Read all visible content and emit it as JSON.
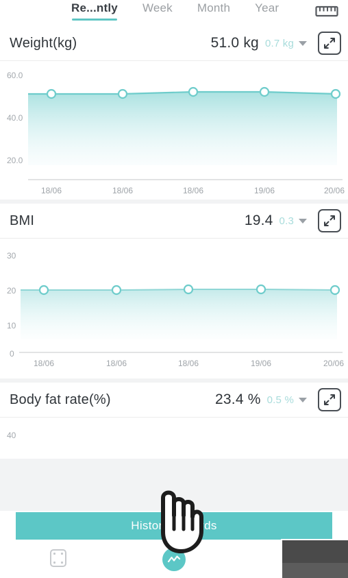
{
  "header": {
    "tabs": [
      {
        "label": "Re...ntly",
        "active": true
      },
      {
        "label": "Week",
        "active": false
      },
      {
        "label": "Month",
        "active": false
      },
      {
        "label": "Year",
        "active": false
      }
    ],
    "ruler_icon": "ruler-icon"
  },
  "colors": {
    "accent": "#5cc7c6",
    "line": "#6ecccb",
    "delta_text": "#a8dcdb",
    "value_text": "#2f3439",
    "tab_inactive": "#9b9fa3",
    "page_bg": "#f2f3f4"
  },
  "cards": [
    {
      "title": "Weight(kg)",
      "value": "51.0 kg",
      "delta": "0.7 kg",
      "expand_icon": "expand-icon",
      "caret_icon": "chevron-down-icon"
    },
    {
      "title": "BMI",
      "value": "19.4",
      "delta": "0.3",
      "expand_icon": "expand-icon",
      "caret_icon": "chevron-down-icon"
    },
    {
      "title": "Body fat rate(%)",
      "value": "23.4 %",
      "delta": "0.5 %",
      "expand_icon": "expand-icon",
      "caret_icon": "chevron-down-icon"
    }
  ],
  "chart_data": [
    {
      "type": "area",
      "title": "Weight(kg)",
      "categories": [
        "18/06",
        "18/06",
        "18/06",
        "19/06",
        "20/06"
      ],
      "values": [
        51.0,
        51.0,
        51.2,
        51.2,
        51.0
      ],
      "xlabel": "",
      "ylabel": "",
      "ylim": [
        10,
        62
      ],
      "yticks": [
        "60.0",
        "40.0",
        "20.0"
      ],
      "ytick_values": [
        60,
        40,
        20
      ],
      "grid": false,
      "legend": "none"
    },
    {
      "type": "area",
      "title": "BMI",
      "categories": [
        "18/06",
        "18/06",
        "18/06",
        "19/06",
        "20/06"
      ],
      "values": [
        19.4,
        19.4,
        19.5,
        19.5,
        19.4
      ],
      "xlabel": "",
      "ylabel": "",
      "ylim": [
        0,
        34
      ],
      "yticks": [
        "30",
        "20",
        "10",
        "0"
      ],
      "ytick_values": [
        30,
        20,
        10,
        0
      ],
      "grid": false,
      "legend": "none"
    },
    {
      "type": "area",
      "title": "Body fat rate(%)",
      "categories": [],
      "values": [],
      "xlabel": "",
      "ylabel": "",
      "ylim": [
        0,
        45
      ],
      "yticks": [
        "40"
      ],
      "ytick_values": [
        40
      ],
      "grid": false,
      "legend": "none"
    }
  ],
  "footer": {
    "history_label": "History Records",
    "nav": [
      {
        "name": "scale-icon",
        "active": false
      },
      {
        "name": "chart-icon",
        "active": true
      }
    ]
  },
  "overlay": {
    "cursor": "hand-pointer-cursor"
  }
}
